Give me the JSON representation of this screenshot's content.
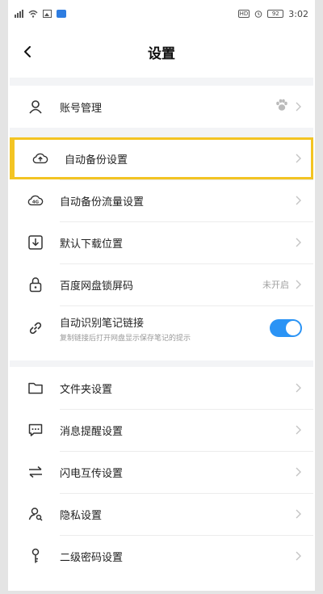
{
  "status_bar": {
    "time": "3:02",
    "hd_label": "HD",
    "battery_label": "92"
  },
  "header": {
    "title": "设置",
    "back_icon": "chevron-left-icon"
  },
  "settings": {
    "account": {
      "label": "账号管理",
      "icon": "user-icon"
    },
    "auto_backup": {
      "label": "自动备份设置",
      "icon": "cloud-upload-icon"
    },
    "backup_data": {
      "label": "自动备份流量设置",
      "icon": "cloud-4g-icon"
    },
    "download_location": {
      "label": "默认下载位置",
      "icon": "download-icon"
    },
    "screen_lock": {
      "label": "百度网盘锁屏码",
      "value": "未开启",
      "icon": "lock-icon"
    },
    "note_link": {
      "label": "自动识别笔记链接",
      "sublabel": "复制链接后打开网盘显示保存笔记的提示",
      "icon": "link-icon",
      "toggle_on": true
    },
    "folder": {
      "label": "文件夹设置",
      "icon": "folder-icon"
    },
    "notifications": {
      "label": "消息提醒设置",
      "icon": "message-icon"
    },
    "flash_transfer": {
      "label": "闪电互传设置",
      "icon": "transfer-icon"
    },
    "privacy": {
      "label": "隐私设置",
      "icon": "privacy-icon"
    },
    "second_password": {
      "label": "二级密码设置",
      "icon": "key-icon"
    }
  },
  "colors": {
    "accent_blue": "#2a93f5",
    "highlight_yellow": "#f3c423"
  }
}
